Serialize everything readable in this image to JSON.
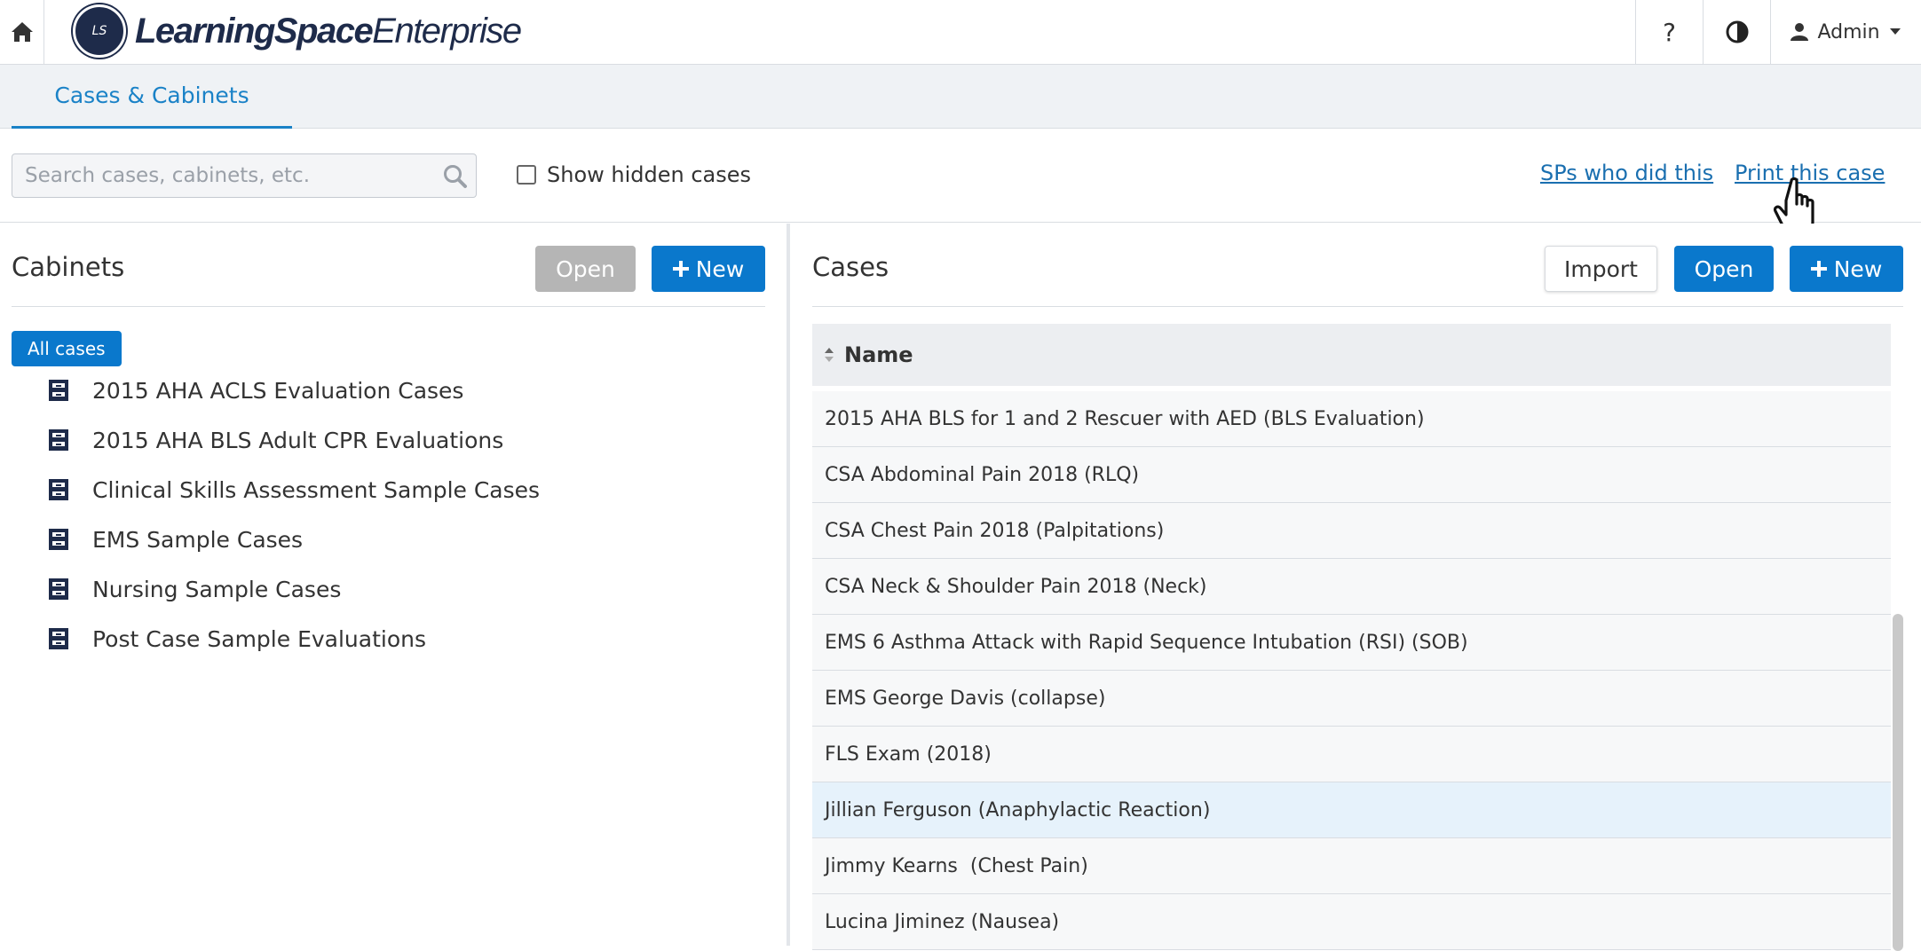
{
  "app": {
    "logo_badge": "LS",
    "logo_bold": "LearningSpace",
    "logo_light": "Enterprise"
  },
  "topbar": {
    "help_label": "?",
    "user_label": "Admin"
  },
  "tabs": [
    {
      "label": "Cases & Cabinets",
      "active": true
    }
  ],
  "toolbar": {
    "search_placeholder": "Search cases, cabinets, etc.",
    "show_hidden_label": "Show hidden cases",
    "show_hidden_checked": false,
    "sps_link": "SPs who did this",
    "print_link": "Print this case"
  },
  "cabinets": {
    "title": "Cabinets",
    "open_label": "Open",
    "new_label": "New",
    "all_cases_label": "All cases",
    "items": [
      "2015 AHA ACLS Evaluation Cases",
      "2015 AHA BLS Adult CPR Evaluations",
      "Clinical Skills Assessment Sample Cases",
      "EMS Sample Cases",
      "Nursing Sample Cases",
      "Post Case Sample Evaluations"
    ]
  },
  "cases": {
    "title": "Cases",
    "import_label": "Import",
    "open_label": "Open",
    "new_label": "New",
    "column_name": "Name",
    "rows": [
      "2015 AHA BLS for 1 and 2 Rescuer with AED (BLS Evaluation)",
      "CSA Abdominal Pain 2018 (RLQ)",
      "CSA Chest Pain 2018 (Palpitations)",
      "CSA Neck & Shoulder Pain 2018 (Neck)",
      "EMS 6 Asthma Attack with Rapid Sequence Intubation (RSI) (SOB)",
      "EMS George Davis (collapse)",
      "FLS Exam (2018)",
      "Jillian Ferguson (Anaphylactic Reaction)",
      "Jimmy Kearns  (Chest Pain)",
      "Lucina Jiminez (Nausea)"
    ],
    "selected_index": 7
  },
  "colors": {
    "accent": "#0a78cc",
    "link": "#1a6fb0",
    "brand_navy": "#1e2b4a"
  }
}
